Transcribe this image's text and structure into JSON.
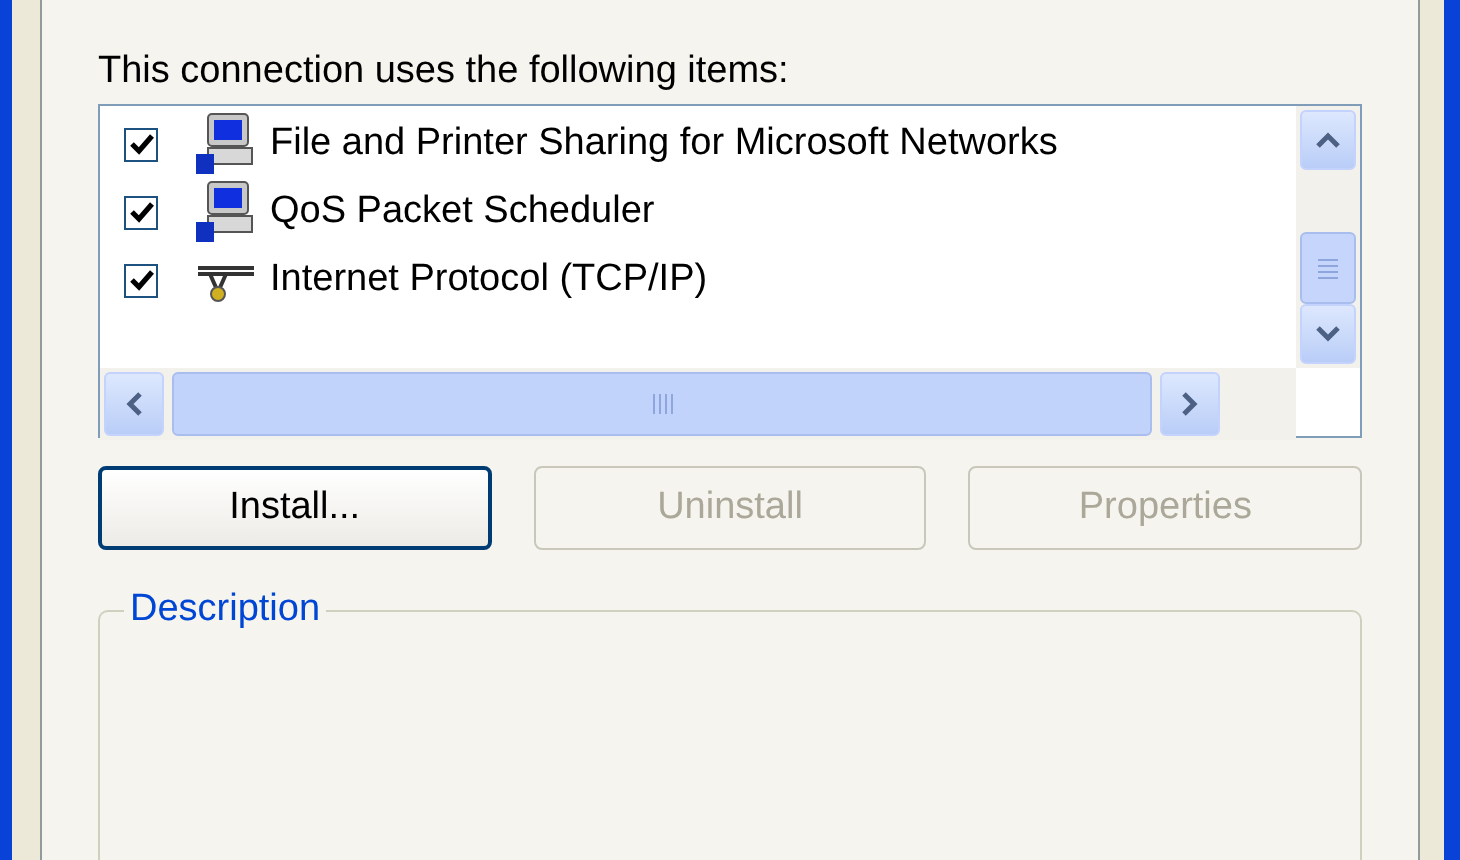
{
  "items_label": "This connection uses the following items:",
  "items": [
    {
      "label": "File and Printer Sharing for Microsoft Networks",
      "checked": true,
      "kind": "computer"
    },
    {
      "label": "QoS Packet Scheduler",
      "checked": true,
      "kind": "computer"
    },
    {
      "label": "Internet Protocol (TCP/IP)",
      "checked": true,
      "kind": "protocol"
    }
  ],
  "buttons": [
    {
      "label": "Install...",
      "disabled": false
    },
    {
      "label": "Uninstall",
      "disabled": true
    },
    {
      "label": "Properties",
      "disabled": true
    }
  ],
  "description": {
    "title": "Description"
  }
}
